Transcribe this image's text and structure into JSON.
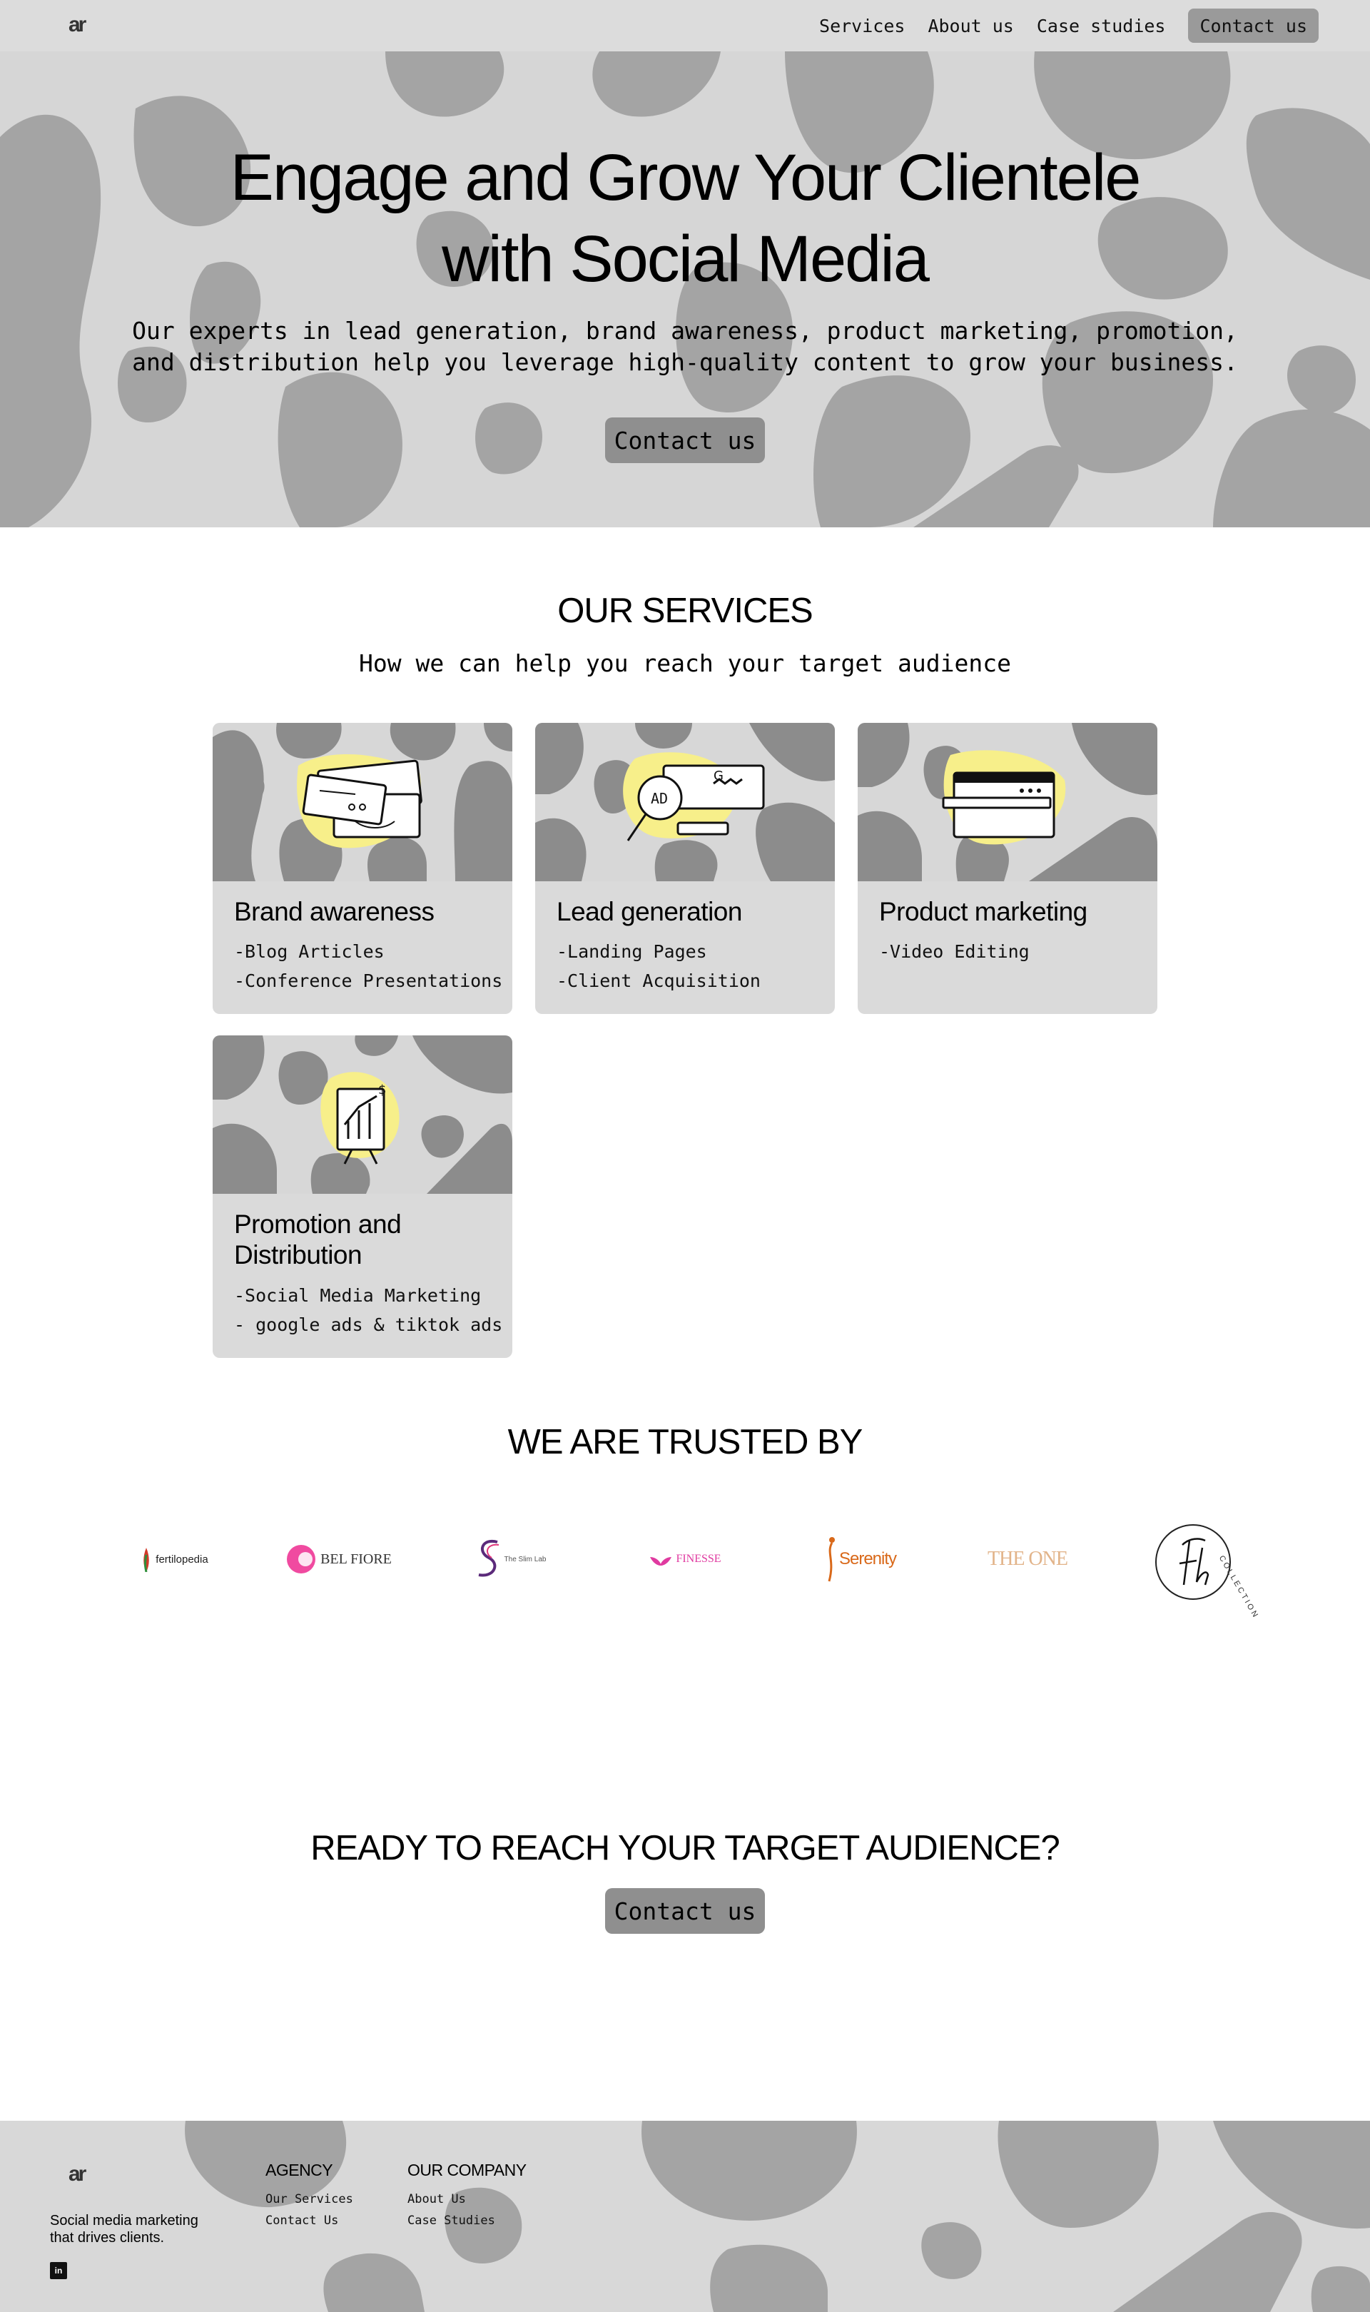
{
  "nav": {
    "links": [
      "Services",
      "About us",
      "Case studies"
    ],
    "cta": "Contact us"
  },
  "hero": {
    "title_line1": "Engage and Grow Your Clientele",
    "title_line2": "with Social Media",
    "sub_line1": "Our experts in lead generation, brand awareness, product marketing, promotion,",
    "sub_line2": "and distribution help you leverage high-quality content to grow your business.",
    "cta": "Contact us"
  },
  "services": {
    "title": "OUR SERVICES",
    "subtitle": "How we can help you reach your target audience",
    "cards": [
      {
        "title": "Brand awareness",
        "items": [
          "-Blog Articles",
          "-Conference Presentations"
        ]
      },
      {
        "title": "Lead generation",
        "items": [
          "-Landing Pages",
          "-Client Acquisition"
        ]
      },
      {
        "title": "Product marketing",
        "items": [
          "-Video Editing"
        ]
      },
      {
        "title_line1": "Promotion and",
        "title_line2": "Distribution",
        "items": [
          "-Social Media Marketing",
          "- google ads & tiktok ads"
        ]
      }
    ]
  },
  "trusted": {
    "title": "WE ARE TRUSTED BY",
    "brands": [
      "fertilopedia",
      "BEL FIORE",
      "The Slim Lab",
      "FINESSE",
      "Serenity",
      "THE ONE",
      "COLLECTION"
    ]
  },
  "cta": {
    "title": "READY TO REACH YOUR TARGET AUDIENCE?",
    "button": "Contact us"
  },
  "footer": {
    "tagline_line1": "Social media marketing",
    "tagline_line2": "that drives clients.",
    "social": "in",
    "agency_title": "AGENCY",
    "agency_links": [
      "Our Services",
      "Contact Us"
    ],
    "company_title": "OUR COMPANY",
    "company_links": [
      "About Us",
      "Case Studies"
    ]
  },
  "colors": {
    "nav_bg": "#dcdcdc",
    "hero_bg": "#d6d6d6",
    "blob": "#a4a4a4",
    "button": "#8f8f8f",
    "card_bg": "#dadada",
    "highlight": "#f7ef8a"
  }
}
